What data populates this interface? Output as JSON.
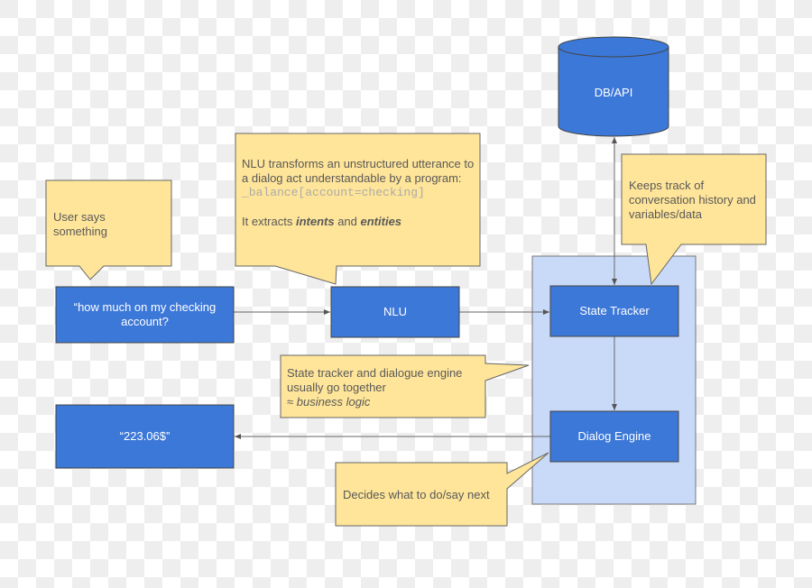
{
  "colors": {
    "node": "#3c78d8",
    "callout": "#ffe599",
    "group": "#c9daf8",
    "line": "#666666"
  },
  "nodes": {
    "db": "DB/API",
    "utterance": "“how much on my checking account?",
    "nlu": "NLU",
    "state_tracker": "State Tracker",
    "dialog_engine": "Dialog Engine",
    "output": "“223.06$”"
  },
  "callouts": {
    "user": "User says something",
    "nlu_line1": "NLU transforms an unstructured utterance to a dialog act understandable by a program:",
    "nlu_code": "_balance[account=checking]",
    "nlu_extract_pre": "It extracts ",
    "nlu_intents": "intents",
    "nlu_and": " and ",
    "nlu_entities": "entities",
    "tracker": "Keeps track of conversation history and variables/data",
    "logic_line": "State tracker and dialogue engine usually go together",
    "logic_em": "≈ business logic",
    "engine": "Decides what to do/say next"
  }
}
